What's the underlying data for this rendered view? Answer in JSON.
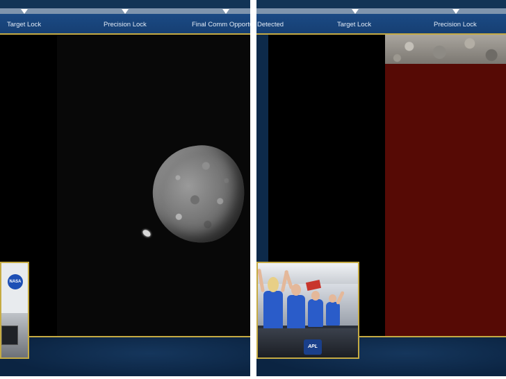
{
  "left_feed": {
    "phases": [
      {
        "label": "Target Lock"
      },
      {
        "label": "Precision Lock"
      },
      {
        "label": "Final Comm Opportu"
      }
    ],
    "inset_logo_text": "NASA"
  },
  "right_feed": {
    "phases": [
      {
        "label": "Detected"
      },
      {
        "label": "Target Lock"
      },
      {
        "label": "Precision Lock"
      }
    ],
    "inset_logo_text": "APL"
  },
  "colors": {
    "bar_blue": "#1b4a84",
    "gold_trim": "#c6ab43",
    "viewport_black": "#000000",
    "red_block": "#560a05"
  }
}
